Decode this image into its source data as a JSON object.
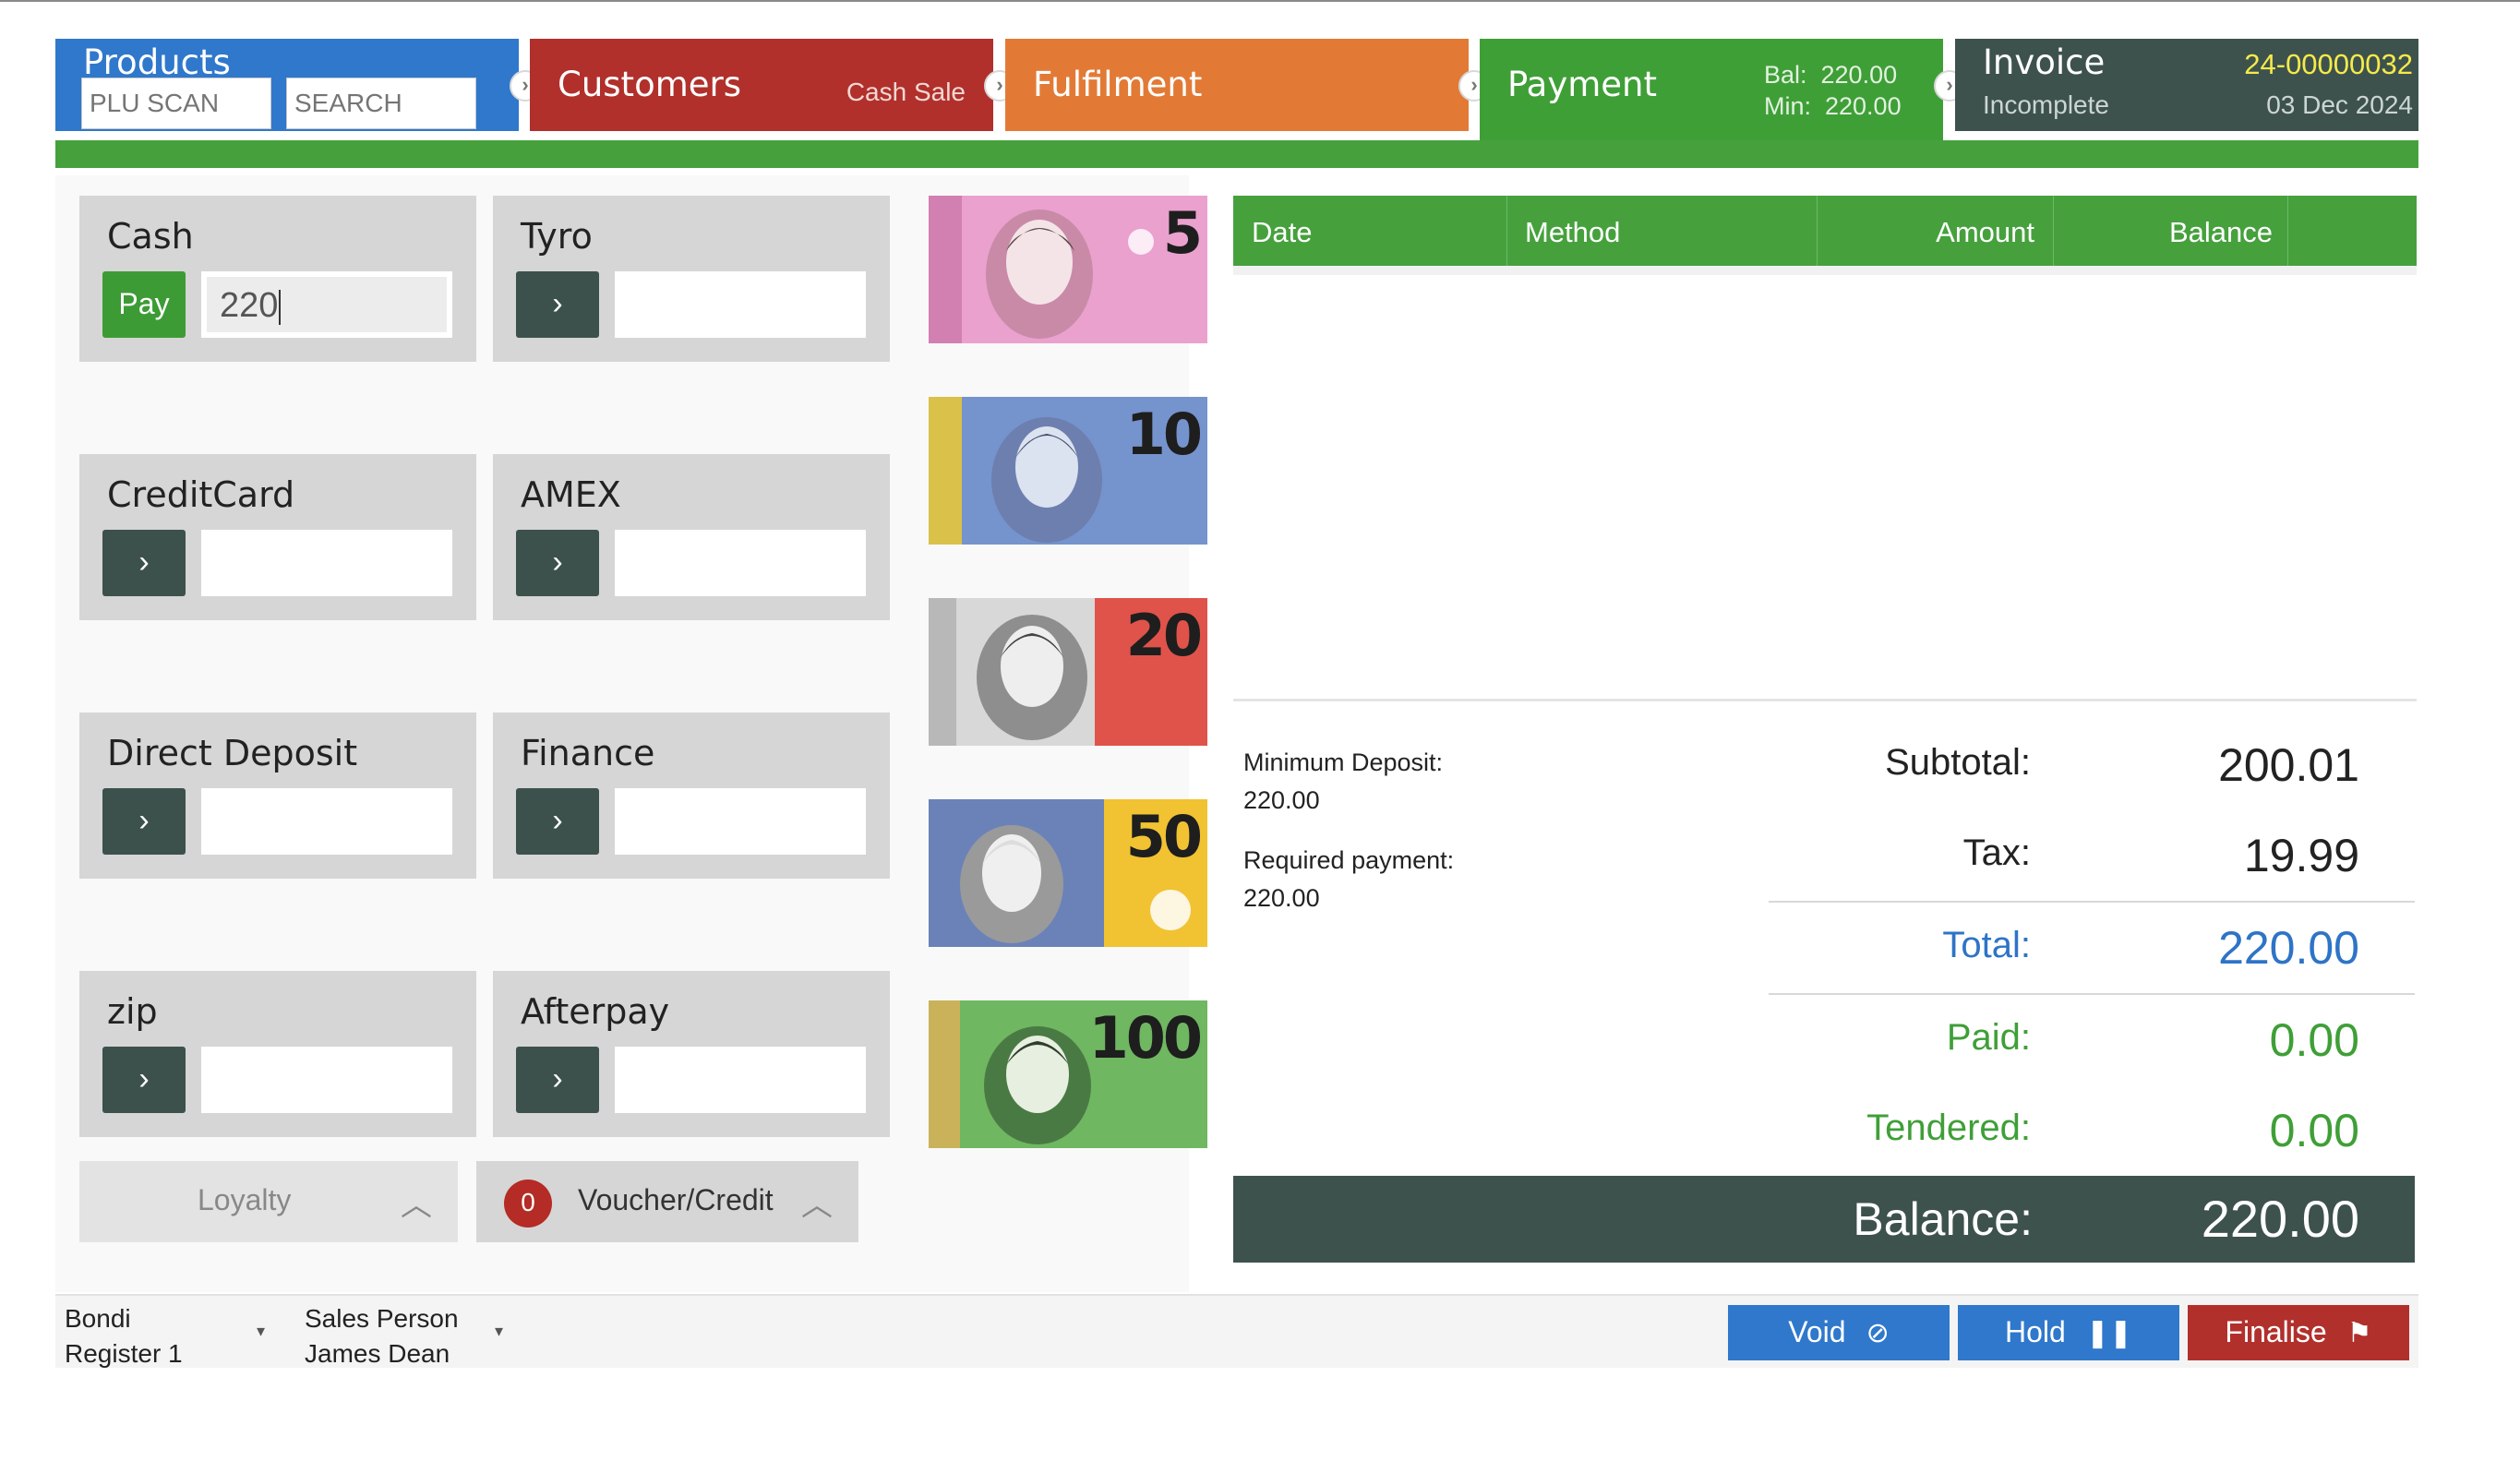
{
  "workflow": {
    "products": {
      "title": "Products",
      "plu_placeholder": "PLU SCAN",
      "search_placeholder": "SEARCH"
    },
    "customers": {
      "title": "Customers",
      "subtitle": "Cash Sale"
    },
    "fulfilment": {
      "title": "Fulfilment"
    },
    "payment": {
      "title": "Payment",
      "bal_line": "Bal:  220.00",
      "min_line": "Min:  220.00"
    },
    "invoice": {
      "title": "Invoice",
      "number": "24-00000032",
      "status": "Incomplete",
      "date": "03 Dec 2024"
    }
  },
  "payment_methods": [
    {
      "label": "Cash",
      "button": "Pay",
      "value": "220"
    },
    {
      "label": "Tyro",
      "button": "›",
      "value": ""
    },
    {
      "label": "CreditCard",
      "button": "›",
      "value": ""
    },
    {
      "label": "AMEX",
      "button": "›",
      "value": ""
    },
    {
      "label": "Direct Deposit",
      "button": "›",
      "value": ""
    },
    {
      "label": "Finance",
      "button": "›",
      "value": ""
    },
    {
      "label": "zip",
      "button": "›",
      "value": ""
    },
    {
      "label": "Afterpay",
      "button": "›",
      "value": ""
    }
  ],
  "drawers": {
    "loyalty": {
      "label": "Loyalty",
      "chevron": "︿"
    },
    "voucher": {
      "label": "Voucher/Credit",
      "count": "0",
      "chevron": "︿"
    }
  },
  "banknotes": [
    {
      "denomination": "5",
      "color": "#e58fc4"
    },
    {
      "denomination": "10",
      "color": "#5b7fbf"
    },
    {
      "denomination": "20",
      "color": "#e0534a"
    },
    {
      "denomination": "50",
      "color": "#f1c232"
    },
    {
      "denomination": "100",
      "color": "#58a848"
    }
  ],
  "payments_table": {
    "columns": [
      "Date",
      "Method",
      "Amount",
      "Balance"
    ],
    "rows": []
  },
  "deposit": {
    "minimum_label": "Minimum Deposit:",
    "minimum_value": "220.00",
    "required_label": "Required payment:",
    "required_value": "220.00"
  },
  "totals": {
    "subtotal_label": "Subtotal:",
    "subtotal": "200.01",
    "tax_label": "Tax:",
    "tax": "19.99",
    "total_label": "Total:",
    "total": "220.00",
    "paid_label": "Paid:",
    "paid": "0.00",
    "tendered_label": "Tendered:",
    "tendered": "0.00",
    "balance_label": "Balance:",
    "balance": "220.00"
  },
  "footer": {
    "store": "Bondi",
    "register": "Register 1",
    "salesperson_label": "Sales Person",
    "salesperson": "James Dean",
    "void_label": "Void",
    "hold_label": "Hold",
    "finalise_label": "Finalise"
  },
  "colors": {
    "products": "#2f78cc",
    "customers": "#b1302b",
    "fulfilment": "#e27a36",
    "payment": "#3f9f37",
    "invoice": "#3e524d",
    "accent_yellow": "#f6ea4a"
  }
}
